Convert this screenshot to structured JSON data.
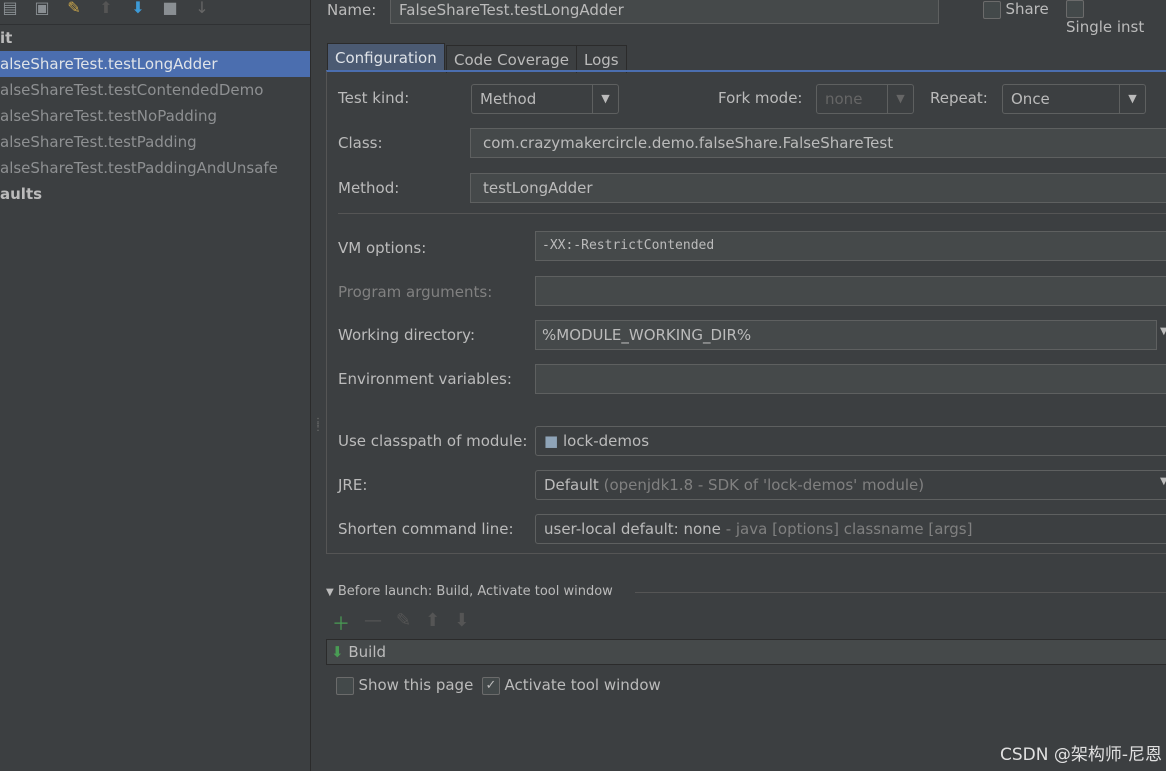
{
  "toolbar": {
    "icons": [
      "copy-icon",
      "save-icon",
      "wrench-icon",
      "arrow-up-icon",
      "arrow-down-icon",
      "folder-icon",
      "sort-az-icon"
    ]
  },
  "tree": {
    "items": [
      {
        "label": "it",
        "bold": true
      },
      {
        "label": "alseShareTest.testLongAdder",
        "selected": true
      },
      {
        "label": "alseShareTest.testContendedDemo"
      },
      {
        "label": "alseShareTest.testNoPadding"
      },
      {
        "label": "alseShareTest.testPadding"
      },
      {
        "label": "alseShareTest.testPaddingAndUnsafe"
      },
      {
        "label": "aults",
        "bold": true
      }
    ]
  },
  "header": {
    "name_label": "Name:",
    "name_value": "FalseShareTest.testLongAdder",
    "share_label": "Share",
    "single_label": "Single inst"
  },
  "tabs": [
    "Configuration",
    "Code Coverage",
    "Logs"
  ],
  "config": {
    "test_kind_label": "Test kind:",
    "test_kind_value": "Method",
    "fork_mode_label": "Fork mode:",
    "fork_mode_value": "none",
    "repeat_label": "Repeat:",
    "repeat_value": "Once",
    "class_label": "Class:",
    "class_value": "com.crazymakercircle.demo.falseShare.FalseShareTest",
    "method_label": "Method:",
    "method_value": "testLongAdder",
    "vm_label": "VM options:",
    "vm_value": "-XX:-RestrictContended",
    "args_label": "Program arguments:",
    "args_value": "",
    "workdir_label": "Working directory:",
    "workdir_value": "%MODULE_WORKING_DIR%",
    "env_label": "Environment variables:",
    "env_value": "",
    "module_label": "Use classpath of module:",
    "module_value": "lock-demos",
    "jre_label": "JRE:",
    "jre_value": "Default",
    "jre_detail": "(openjdk1.8 - SDK of 'lock-demos' module)",
    "shorten_label": "Shorten command line:",
    "shorten_value": "user-local default: none",
    "shorten_detail": "- java [options] classname [args]"
  },
  "before_launch": {
    "title": "Before launch: Build, Activate tool window",
    "item": "Build",
    "show_page_label": "Show this page",
    "show_page_checked": false,
    "activate_label": "Activate tool window",
    "activate_checked": true
  },
  "watermark": "CSDN @架构师-尼恩",
  "colors": {
    "background": "#3c3f41",
    "selection": "#4b6eaf",
    "add": "#499c54"
  }
}
